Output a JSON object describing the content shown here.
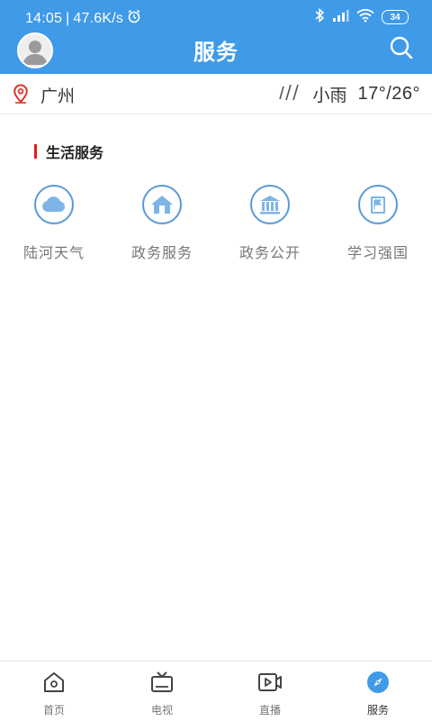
{
  "status": {
    "time": "14:05",
    "speed": "47.6K/s",
    "battery": "34"
  },
  "header": {
    "title": "服务"
  },
  "location": {
    "city": "广州",
    "weather_text": "小雨",
    "temperature": "17°/26°"
  },
  "section": {
    "title": "生活服务"
  },
  "services": [
    {
      "label": "陆河天气",
      "icon": "cloud-icon"
    },
    {
      "label": "政务服务",
      "icon": "house-icon"
    },
    {
      "label": "政务公开",
      "icon": "bank-icon"
    },
    {
      "label": "学习强国",
      "icon": "flag-book-icon"
    }
  ],
  "nav": [
    {
      "label": "首页",
      "icon": "home-icon"
    },
    {
      "label": "电视",
      "icon": "tv-icon"
    },
    {
      "label": "直播",
      "icon": "video-icon"
    },
    {
      "label": "服务",
      "icon": "compass-icon",
      "active": true
    }
  ],
  "colors": {
    "brand": "#3f9ae8",
    "icon_blue": "#5b9ad6",
    "accent_red": "#e02020"
  }
}
